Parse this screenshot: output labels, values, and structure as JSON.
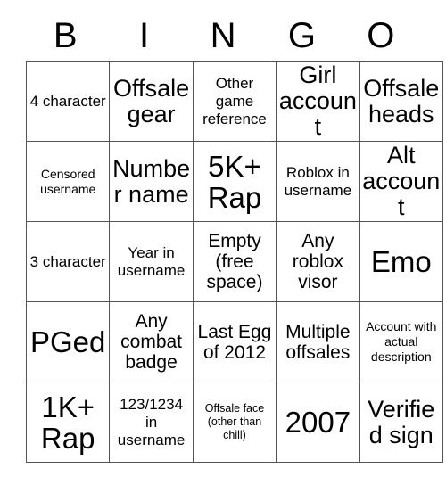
{
  "header": {
    "letters": [
      "B",
      "I",
      "N",
      "G",
      "O"
    ]
  },
  "grid": {
    "rows": [
      [
        {
          "text": "4 character",
          "size": "fs-md"
        },
        {
          "text": "Offsale gear",
          "size": "fs-xl"
        },
        {
          "text": "Other game reference",
          "size": "fs-md"
        },
        {
          "text": "Girl account",
          "size": "fs-xl"
        },
        {
          "text": "Offsale heads",
          "size": "fs-xl"
        }
      ],
      [
        {
          "text": "Censored username",
          "size": "fs-sm"
        },
        {
          "text": "Number name",
          "size": "fs-xl"
        },
        {
          "text": "5K+ Rap",
          "size": "fs-xxl"
        },
        {
          "text": "Roblox in username",
          "size": "fs-md"
        },
        {
          "text": "Alt account",
          "size": "fs-xl"
        }
      ],
      [
        {
          "text": "3 character",
          "size": "fs-md"
        },
        {
          "text": "Year in username",
          "size": "fs-md"
        },
        {
          "text": "Empty (free space)",
          "size": "fs-lg"
        },
        {
          "text": "Any roblox visor",
          "size": "fs-lg"
        },
        {
          "text": "Emo",
          "size": "fs-xxl"
        }
      ],
      [
        {
          "text": "PGed",
          "size": "fs-xxl"
        },
        {
          "text": "Any combat badge",
          "size": "fs-lg"
        },
        {
          "text": "Last Egg of 2012",
          "size": "fs-lg"
        },
        {
          "text": "Multiple offsales",
          "size": "fs-lg"
        },
        {
          "text": "Account with actual description",
          "size": "fs-sm"
        }
      ],
      [
        {
          "text": "1K+ Rap",
          "size": "fs-xxl"
        },
        {
          "text": "123/1234 in username",
          "size": "fs-md"
        },
        {
          "text": "Offsale face (other than chill)",
          "size": "fs-xs"
        },
        {
          "text": "2007",
          "size": "fs-xxl"
        },
        {
          "text": "Verified sign",
          "size": "fs-xl"
        }
      ]
    ]
  }
}
